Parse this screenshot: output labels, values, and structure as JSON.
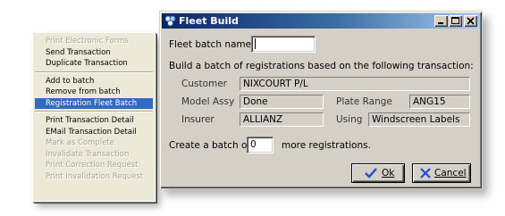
{
  "context_menu": {
    "items": [
      {
        "label": "Print Electronic Forms",
        "enabled": false
      },
      {
        "label": "Send Transaction",
        "enabled": true
      },
      {
        "label": "Duplicate Transaction",
        "enabled": true
      },
      {
        "separator": true
      },
      {
        "label": "Add to batch",
        "enabled": true
      },
      {
        "label": "Remove from batch",
        "enabled": true
      },
      {
        "label": "Registration Fleet Batch",
        "enabled": true,
        "selected": true
      },
      {
        "separator": true
      },
      {
        "label": "Print Transaction Detail",
        "enabled": true
      },
      {
        "label": "EMail Transaction Detail",
        "enabled": true
      },
      {
        "label": "Mark as Complete",
        "enabled": false
      },
      {
        "label": "Invalidate Transaction",
        "enabled": false
      },
      {
        "label": "Print Correction Request",
        "enabled": false
      },
      {
        "label": "Print Invalidation Request",
        "enabled": false
      }
    ]
  },
  "dialog": {
    "title": "Fleet Build",
    "fleet_batch_name_label": "Fleet batch name",
    "fleet_batch_name_value": "",
    "description": "Build a batch of registrations based on the following transaction:",
    "customer_label": "Customer",
    "customer_value": "NIXCOURT P/L",
    "model_assy_label": "Model Assy",
    "model_assy_value": "Done",
    "plate_range_label": "Plate Range",
    "plate_range_value": "ANG15",
    "insurer_label": "Insurer",
    "insurer_value": "ALLIANZ",
    "using_label": "Using",
    "using_value": "Windscreen Labels",
    "create_prefix": "Create a batch of",
    "batch_count": "0",
    "create_suffix": "more registrations.",
    "ok_label": "Ok",
    "cancel_label": "Cancel"
  },
  "colors": {
    "title_gradient_start": "#0a246a",
    "title_gradient_end": "#a6caf0",
    "menu_selection": "#316ac5",
    "dialog_face": "#d4d0c8",
    "ok_check": "#1c4fd6",
    "cancel_x": "#1c4fd6"
  },
  "icons": {
    "window": "app-window-icon",
    "minimize": "minimize-icon",
    "maximize": "maximize-icon",
    "close": "close-icon",
    "ok": "checkmark-icon",
    "cancel": "cancel-x-icon"
  }
}
